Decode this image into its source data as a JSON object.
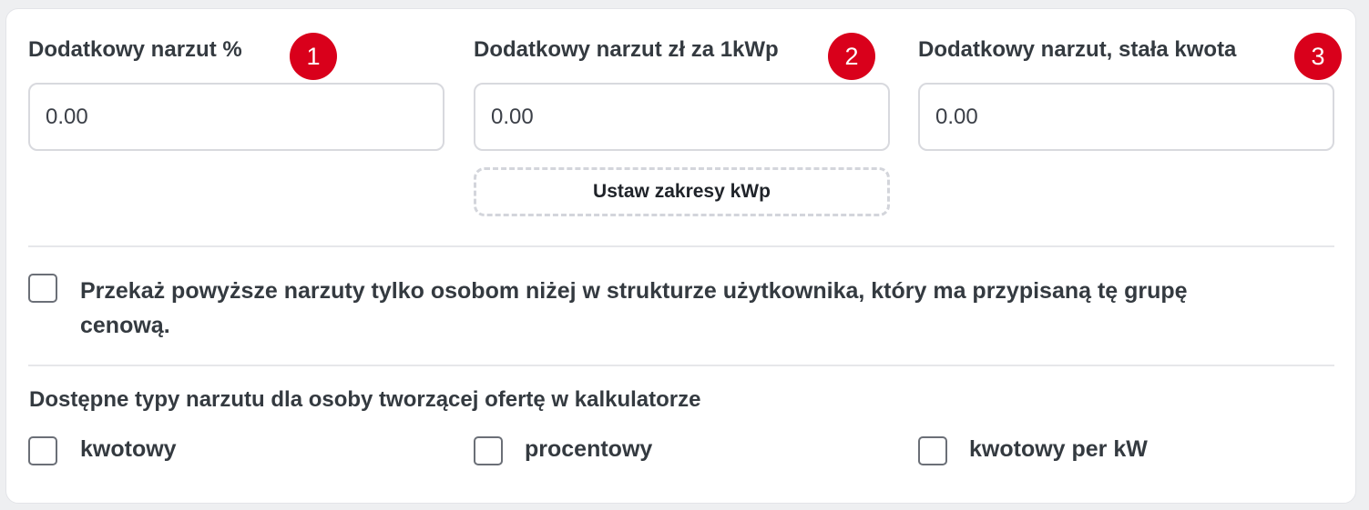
{
  "fields": [
    {
      "label": "Dodatkowy narzut %",
      "badge": "1",
      "value": "0.00"
    },
    {
      "label": "Dodatkowy narzut zł za 1kWp",
      "badge": "2",
      "value": "0.00"
    },
    {
      "label": "Dodatkowy narzut, stała kwota",
      "badge": "3",
      "value": "0.00"
    }
  ],
  "ranges_button": "Ustaw zakresy kWp",
  "pass_markups": {
    "label": "Przekaż powyższe narzuty tylko osobom niżej w strukturze użytkownika, który ma przypisaną tę grupę cenową.",
    "checked": false
  },
  "markup_types": {
    "title": "Dostępne typy narzutu dla osoby tworzącej ofertę w kalkulatorze",
    "options": [
      {
        "label": "kwotowy",
        "checked": false
      },
      {
        "label": "procentowy",
        "checked": false
      },
      {
        "label": "kwotowy per kW",
        "checked": false
      }
    ]
  },
  "colors": {
    "badge": "#d9001b",
    "border": "#d8d9de",
    "text": "#343a40"
  }
}
